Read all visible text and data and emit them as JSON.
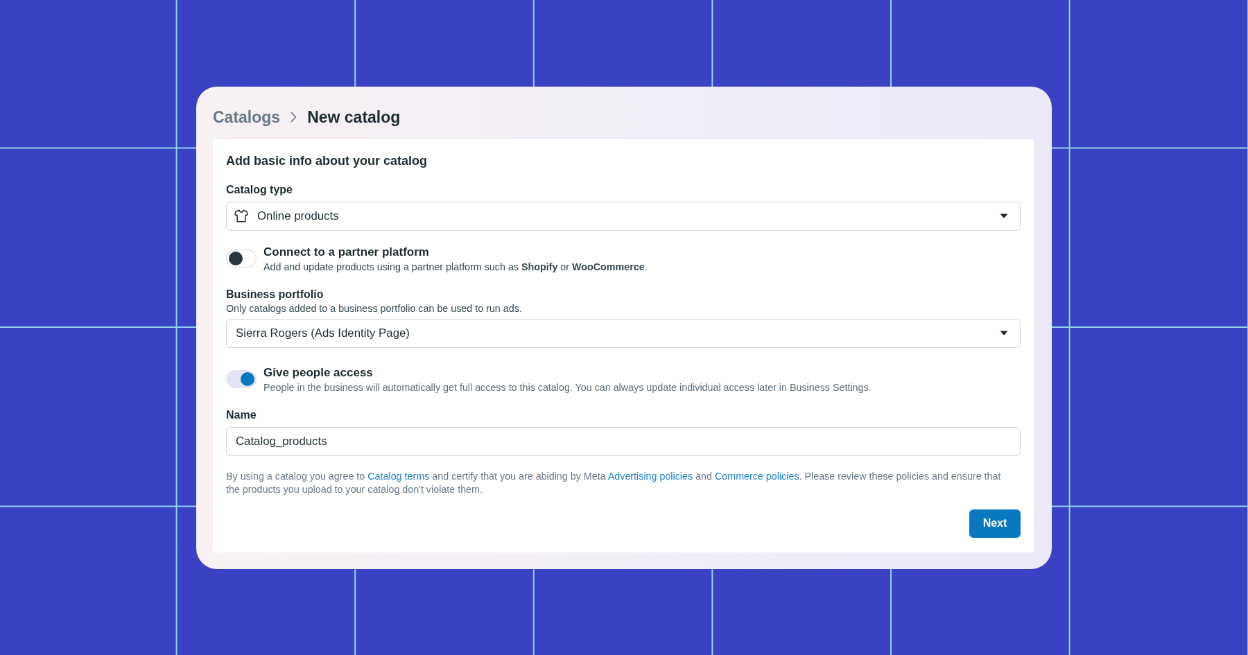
{
  "breadcrumb": [
    {
      "label": "Catalogs",
      "current": false
    },
    {
      "label": "New catalog",
      "current": true
    }
  ],
  "heading": "Add basic info about your catalog",
  "catalog_type": {
    "label": "Catalog type",
    "value": "Online products"
  },
  "partner_platform": {
    "title": "Connect to a partner platform",
    "description": "Add and update products using a partner platform such as **Shopify** or **WooCommerce**.",
    "on": false
  },
  "business_portfolio": {
    "label": "Business portfolio",
    "hint": "Only catalogs added to a business portfolio can be used to run ads.",
    "value": "Sierra Rogers (Ads Identity Page)"
  },
  "people_access": {
    "title": "Give people access",
    "description": "People in the business will automatically get full access to this catalog. You can always update individual access later in Business Settings.",
    "on": true
  },
  "name": {
    "label": "Name",
    "value": "Catalog_products"
  },
  "terms": [
    {
      "kind": "text",
      "text": "By using a catalog you agree to "
    },
    {
      "kind": "link",
      "text": "Catalog terms"
    },
    {
      "kind": "text",
      "text": " and certify that you are abiding by Meta "
    },
    {
      "kind": "link",
      "text": "Advertising policies"
    },
    {
      "kind": "text",
      "text": " and "
    },
    {
      "kind": "link",
      "text": "Commerce policies"
    },
    {
      "kind": "text",
      "text": ". Please review these policies and ensure that the products you upload to your catalog don't violate them."
    }
  ],
  "next_button": "Next"
}
